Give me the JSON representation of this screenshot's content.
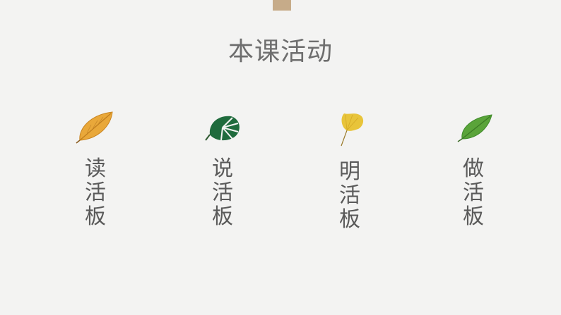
{
  "slide": {
    "title": "本课活动",
    "activities": [
      {
        "label": "读\n活\n板",
        "icon": "orange-leaf-icon"
      },
      {
        "label": "说\n活\n板",
        "icon": "monstera-leaf-icon"
      },
      {
        "label": "明\n活\n板",
        "icon": "ginkgo-leaf-icon"
      },
      {
        "label": "做\n活\n板",
        "icon": "green-leaf-icon"
      }
    ]
  },
  "colors": {
    "background": "#f3f3f2",
    "accent_tab": "#c6ab89",
    "title_text": "#6e6e6e",
    "label_text": "#5a5a5a"
  }
}
